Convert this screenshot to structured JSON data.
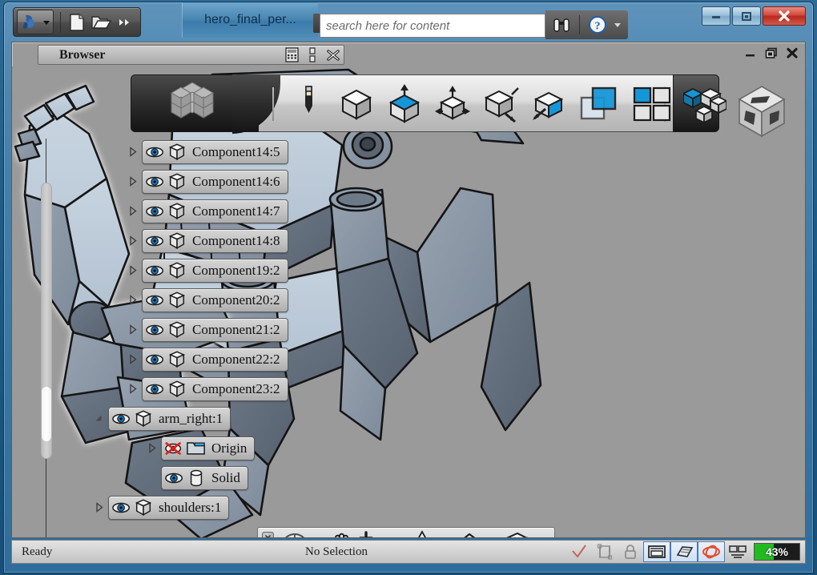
{
  "window": {
    "document_title": "hero_final_per...",
    "search_placeholder": "search here for content",
    "minimize_label": "—",
    "maximize_label": "□",
    "close_label": "✕"
  },
  "quick_access": {
    "app_button": "app-logo",
    "items": [
      {
        "name": "new-file-icon",
        "label": "New"
      },
      {
        "name": "open-folder-icon",
        "label": "Open"
      },
      {
        "name": "overflow-chevrons-icon",
        "label": "More"
      }
    ],
    "search_tools": [
      {
        "name": "binoculars-icon",
        "label": "Search"
      },
      {
        "name": "help-icon",
        "label": "Help"
      },
      {
        "name": "help-dropdown-icon",
        "label": "Help options"
      }
    ]
  },
  "browser_panel": {
    "title": "Browser",
    "buttons": [
      {
        "name": "keypad-icon",
        "label": "Filter"
      },
      {
        "name": "dots-icon",
        "label": "Options"
      },
      {
        "name": "close-panel-icon",
        "label": "Close"
      }
    ]
  },
  "doc_window_controls": [
    {
      "name": "doc-minimize-icon",
      "label": "—"
    },
    {
      "name": "doc-restore-icon",
      "label": "❐"
    },
    {
      "name": "doc-close-icon",
      "label": "✕"
    }
  ],
  "ribbon": {
    "tab_icon": "cube-grid-icon",
    "tools": [
      {
        "name": "pencil-icon",
        "label": "Sketch"
      },
      {
        "name": "cube-icon",
        "label": "Create"
      },
      {
        "name": "extrude-cube-icon",
        "label": "Extrude"
      },
      {
        "name": "move-cube-icon",
        "label": "Modify"
      },
      {
        "name": "measure-cube-icon",
        "label": "Inspect"
      },
      {
        "name": "select-cube-icon",
        "label": "Select"
      },
      {
        "name": "layers-icon",
        "label": "Layers"
      },
      {
        "name": "grid-windows-icon",
        "label": "Window"
      },
      {
        "name": "assembly-cubes-icon",
        "label": "Assemble"
      }
    ]
  },
  "tree": {
    "items": [
      {
        "label": "Component14:5",
        "indent": 1,
        "expander": "collapsed",
        "icon": "visibility-eye-icon",
        "type_icon": "component-cube-icon"
      },
      {
        "label": "Component14:6",
        "indent": 1,
        "expander": "collapsed",
        "icon": "visibility-eye-icon",
        "type_icon": "component-cube-icon"
      },
      {
        "label": "Component14:7",
        "indent": 1,
        "expander": "collapsed",
        "icon": "visibility-eye-icon",
        "type_icon": "component-cube-icon"
      },
      {
        "label": "Component14:8",
        "indent": 1,
        "expander": "collapsed",
        "icon": "visibility-eye-icon",
        "type_icon": "component-cube-icon"
      },
      {
        "label": "Component19:2",
        "indent": 1,
        "expander": "collapsed",
        "icon": "visibility-eye-icon",
        "type_icon": "component-cube-icon"
      },
      {
        "label": "Component20:2",
        "indent": 1,
        "expander": "collapsed",
        "icon": "visibility-eye-icon",
        "type_icon": "component-cube-icon"
      },
      {
        "label": "Component21:2",
        "indent": 1,
        "expander": "collapsed",
        "icon": "visibility-eye-icon",
        "type_icon": "component-cube-icon"
      },
      {
        "label": "Component22:2",
        "indent": 1,
        "expander": "collapsed",
        "icon": "visibility-eye-icon",
        "type_icon": "component-cube-icon"
      },
      {
        "label": "Component23:2",
        "indent": 1,
        "expander": "collapsed",
        "icon": "visibility-eye-icon",
        "type_icon": "component-cube-icon"
      },
      {
        "label": "arm_right:1",
        "indent": 0,
        "expander": "expanded",
        "icon": "visibility-eye-icon",
        "type_icon": "component-cube-icon"
      },
      {
        "label": "Origin",
        "indent": 2,
        "expander": "collapsed",
        "icon": "visibility-hidden-icon",
        "type_icon": "folder-icon"
      },
      {
        "label": "Solid",
        "indent": 2,
        "expander": "none",
        "icon": "visibility-eye-icon",
        "type_icon": "solid-cylinder-icon"
      },
      {
        "label": "shoulders:1",
        "indent": 0,
        "expander": "collapsed",
        "icon": "visibility-eye-icon",
        "type_icon": "component-cube-icon"
      }
    ]
  },
  "navbar": {
    "close_label": "✕",
    "minimize_label": "—",
    "tools": [
      {
        "name": "orbit-wheel-icon",
        "label": "Full Navigation Wheel",
        "caret": true
      },
      {
        "name": "pan-hand-icon",
        "label": "Pan",
        "caret": false
      },
      {
        "name": "zoom-magnifier-icon",
        "label": "Zoom",
        "caret": true
      },
      {
        "name": "orbit-icon",
        "label": "Orbit",
        "caret": true
      },
      {
        "name": "look-at-icon",
        "label": "Look At",
        "caret": false
      },
      {
        "name": "view-cube-icon",
        "label": "Constrained Orbit",
        "caret": true
      }
    ]
  },
  "statusbar": {
    "ready_text": "Ready",
    "selection_text": "No Selection",
    "icons": [
      {
        "name": "check-mark-icon",
        "framed": false,
        "label": "Update"
      },
      {
        "name": "sketch-constraint-icon",
        "framed": false,
        "label": "Constraints"
      },
      {
        "name": "lock-icon",
        "framed": false,
        "label": "Lock"
      },
      {
        "name": "document-view-icon",
        "framed": true,
        "label": "Document"
      },
      {
        "name": "ground-plane-icon",
        "framed": true,
        "label": "Ground Plane"
      },
      {
        "name": "orbit-red-icon",
        "framed": true,
        "label": "Free Orbit"
      },
      {
        "name": "dual-monitor-icon",
        "framed": false,
        "label": "Display"
      }
    ],
    "progress": {
      "value": 43,
      "text": "43%",
      "fill_color": "#21bb21",
      "track_color": "#1c1c1c"
    }
  },
  "viewport": {
    "background_color": "#9a9a9a",
    "model_name": "hero-robot-assembly",
    "viewcube_name": "view-cube"
  }
}
